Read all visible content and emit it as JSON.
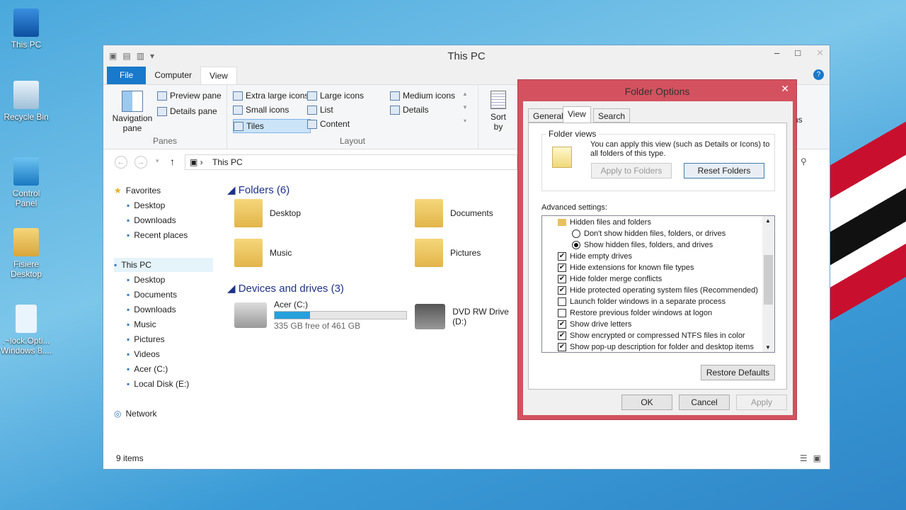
{
  "desktop": {
    "icons": [
      "This PC",
      "Recycle Bin",
      "Control Panel",
      "Fisiere Desktop",
      ".~lock.Opti... Windows 8...."
    ]
  },
  "explorer": {
    "title": "This PC",
    "tabs": [
      "File",
      "Computer",
      "View"
    ],
    "panes": {
      "navigation_pane": "Navigation pane",
      "preview_pane": "Preview pane",
      "details_pane": "Details pane",
      "label": "Panes"
    },
    "layout": {
      "items": [
        "Extra large icons",
        "Large icons",
        "Medium icons",
        "Small icons",
        "List",
        "Details",
        "Tiles",
        "Content"
      ],
      "selected": "Tiles",
      "label": "Layout"
    },
    "sort_by": "Sort by",
    "partial_label": "ns",
    "address": "This PC",
    "nav": {
      "favorites": "Favorites",
      "fav_items": [
        "Desktop",
        "Downloads",
        "Recent places"
      ],
      "this_pc": "This PC",
      "pc_items": [
        "Desktop",
        "Documents",
        "Downloads",
        "Music",
        "Pictures",
        "Videos",
        "Acer (C:)",
        "Local Disk (E:)"
      ],
      "network": "Network"
    },
    "folders_header": "Folders (6)",
    "folders": [
      "Desktop",
      "Documents",
      "Music",
      "Pictures"
    ],
    "devices_header": "Devices and drives (3)",
    "drive_c": {
      "name": "Acer (C:)",
      "free": "335 GB free of 461 GB",
      "used_fraction": 0.27
    },
    "dvd": "DVD RW Drive (D:)",
    "status": "9 items"
  },
  "dialog": {
    "title": "Folder Options",
    "tabs": [
      "General",
      "View",
      "Search"
    ],
    "folder_views": {
      "label": "Folder views",
      "text": "You can apply this view (such as Details or Icons) to all folders of this type.",
      "apply": "Apply to Folders",
      "reset": "Reset Folders"
    },
    "advanced_label": "Advanced settings:",
    "settings": [
      {
        "type": "folder",
        "label": "Hidden files and folders"
      },
      {
        "type": "radio",
        "checked": false,
        "label": "Don't show hidden files, folders, or drives"
      },
      {
        "type": "radio",
        "checked": true,
        "label": "Show hidden files, folders, and drives"
      },
      {
        "type": "check",
        "checked": true,
        "label": "Hide empty drives"
      },
      {
        "type": "check",
        "checked": true,
        "label": "Hide extensions for known file types"
      },
      {
        "type": "check",
        "checked": true,
        "label": "Hide folder merge conflicts"
      },
      {
        "type": "check",
        "checked": true,
        "label": "Hide protected operating system files (Recommended)"
      },
      {
        "type": "check",
        "checked": false,
        "label": "Launch folder windows in a separate process"
      },
      {
        "type": "check",
        "checked": false,
        "label": "Restore previous folder windows at logon"
      },
      {
        "type": "check",
        "checked": true,
        "label": "Show drive letters"
      },
      {
        "type": "check",
        "checked": true,
        "label": "Show encrypted or compressed NTFS files in color"
      },
      {
        "type": "check",
        "checked": true,
        "label": "Show pop-up description for folder and desktop items"
      }
    ],
    "restore_defaults": "Restore Defaults",
    "ok": "OK",
    "cancel": "Cancel",
    "apply": "Apply"
  }
}
